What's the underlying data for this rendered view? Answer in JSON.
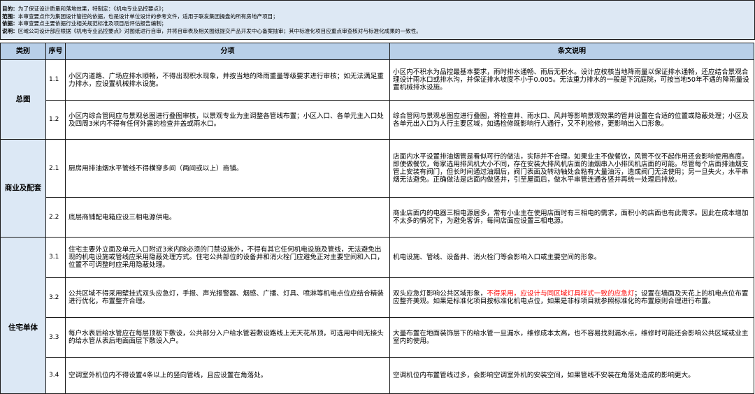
{
  "info": {
    "lines": [
      {
        "label": "目的：",
        "text": "为了保证设计质量和落地效果，特制定：《机电专业品控要点》；"
      },
      {
        "label": "范围：",
        "text": "本审查要点作为集团设计管控的依据，也是设计单位设计的参考文件，适用于联发集团操盘的所有房地产项目；"
      },
      {
        "label": "依据：",
        "text": "本审查要点主要依据行业相关规范标准及项目后评估报告编制；"
      },
      {
        "label": "说明：",
        "text": "区域公司设计部应根据《机电专业品控要点》对图纸进行自审，并将自审表及相关图纸提交产品开发中心备案抽审；其中标准化项目应重点审查核对与标准化成果的一致性。"
      }
    ]
  },
  "table": {
    "headers": {
      "category": "类别",
      "seq": "序号",
      "item": "分项",
      "note": "条文说明"
    },
    "groups": [
      {
        "category": "总图",
        "rows": [
          {
            "seq": "1.1",
            "item": "小区内道路、广场应排水顺畅，不得出现积水现象，并按当地的降雨重量等级要求进行审核；如无法满足重力排水，应设置机械排水设施。",
            "note": "小区内不积水为品控最基本要求，雨时排水通畅、雨后无积水。设计应校核当地降雨量以保证排水通畅，还应结合景观合理设计雨水口或排水沟，并保证排水坡度不小于0.005。无法重力排水的一般是下沉庭院，可按当地50年不遇的降雨量设置机械排水设施。"
          },
          {
            "seq": "1.2",
            "item": "小区内综合管网应与景观总图进行叠图审核，以景观专业为主调整各管线布置；小区入口、各单元主入口处及四周3米内不得有任何外露的检查井盖或雨水口。",
            "note": "综合管网与景观总图应进行叠图，将检查井、雨水口、风井等影响景观效果的管井设置在合适的位置或隐蔽处理；小区及各单元出入口为人行主要区域，如遇检修既影响行人通行，又不利检修，更影响出入口形象。"
          }
        ]
      },
      {
        "category": "商业及配套",
        "rows": [
          {
            "seq": "2.1",
            "item": "厨房用排油烟水平管线不得横穿多间（两间或以上）商铺。",
            "note": "店面内水平设置排油烟管是看似可行的做法，实际并不合理。如果业主不做餐饮，风管不仅不起作用还会影响使用高度。即使做餐饮，每家选用排风机大小不同，存在安装大排风机店面的油烟串入小排风机店面的可能。尽管每个店面排油烟支管上安装有阀门，但长时间通过油烟后，阀门表面及转动轴处会粘有大量油污，造成阀门无法使用；另一旦失火，水平串烟无法避免。正确做法是店面内做竖井，引至屋面后，做水平串管连通各竖井再统一处理后排放。"
          },
          {
            "seq": "2.2",
            "item": "底层商铺配电箱应设三相电源供电。",
            "note": "商业店面内的电器三相电源居多，常有小业主在使用店面时有三相电的需求，面积小的店面也有此需求。因此在成本增加不太多的情况下，为避免客诉，每间店面应设置三相电源。"
          }
        ]
      },
      {
        "category": "住宅单体",
        "rows": [
          {
            "seq": "3.1",
            "item": "住宅主要外立面及单元入口附近3米内除必须的门禁设施外，不得有其它任何机电设施及管线，无法避免出现的机电设施或管线应采用隐蔽处理方式。住宅公共部位的设备井和消火栓门应避免正对主要空间和入口，位置不可调整时应采用隐蔽处理。",
            "note": "机电设施、管线、设备井、消火栓门等会影响入口或主要空间的形象。"
          },
          {
            "seq": "3.2",
            "item": "公共区域不得采用壁挂式双头应急灯，手报、声光报警器、烟感、广播、灯具、喷淋等机电点位应结合精装进行优化，布置整齐合理。",
            "note": "双头应急灯影响公共区域形象，",
            "note_highlight": "不得采用，应设计与同区域灯具样式一致的应急灯",
            "note_after": "；设置在墙面及天花上的机电点位布置应整齐美观。如果是标准化项目按标准化机电点位，如果是非标项目就参照标准化的布置原则合理进行布置。"
          },
          {
            "seq": "3.3",
            "item": "每户水表后给水管应在每层顶板下敷设，公共部分入户给水管若敷设路线上无天花吊顶，可选用中间无接头的给水管从表后地面面层下敷设入户。",
            "note": "大量布置在地面装饰层下的给水管一旦漏水，维修成本太高，也不容易找到漏水点，维修时可能还会影响公共区域或业主室内的使用。"
          },
          {
            "seq": "3.4",
            "item": "空调室外机位内不得设置4条以上的竖向管线，且应设置在角落处。",
            "note": "空调机位内布置管线过多，会影响空调室外机的安装空间，如果管线不安装在角落处造成的影响更大。"
          }
        ]
      }
    ]
  },
  "colors": {
    "info_background": "#dde8f4",
    "header_background": "#b8cfe8",
    "category_background": "#dce8f5",
    "grid": "#1a1a1a",
    "text": "#000000",
    "highlight": "#ff0000"
  }
}
